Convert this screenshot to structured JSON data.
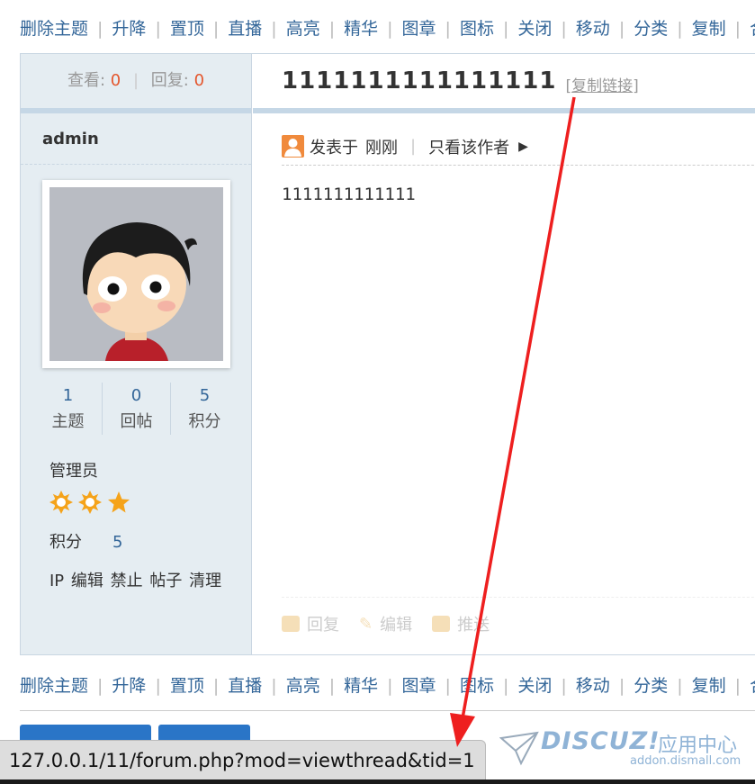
{
  "mod_actions": [
    "删除主题",
    "升降",
    "置顶",
    "直播",
    "高亮",
    "精华",
    "图章",
    "图标",
    "关闭",
    "移动",
    "分类",
    "复制",
    "合并"
  ],
  "stats": {
    "views_label": "查看:",
    "views": "0",
    "replies_label": "回复:",
    "replies": "0"
  },
  "thread": {
    "title": "1111111111111111",
    "copy_link": "复制链接",
    "bracket_open": "[",
    "bracket_close": "]"
  },
  "author": {
    "name": "admin",
    "counts": [
      {
        "value": "1",
        "label": "主题"
      },
      {
        "value": "0",
        "label": "回帖"
      },
      {
        "value": "5",
        "label": "积分"
      }
    ],
    "group": "管理员",
    "credit_label": "积分",
    "credit_value": "5",
    "admin_links": [
      "IP",
      "编辑",
      "禁止",
      "帖子",
      "清理"
    ]
  },
  "post": {
    "posted_label": "发表于",
    "posted_time": "刚刚",
    "only_author": "只看该作者",
    "body": "1111111111111",
    "actions": [
      "回复",
      "编辑",
      "推送"
    ]
  },
  "statusbar": {
    "url": "127.0.0.1/11/forum.php?mod=viewthread&tid=1"
  },
  "watermark": {
    "brand": "DISCUZ!",
    "cn": "应用中心",
    "url": "addon.dismall.com"
  },
  "colors": {
    "link": "#336699",
    "accent": "#e4572e",
    "arrow": "#ee1f1f",
    "sidebar": "#e5edf2"
  }
}
